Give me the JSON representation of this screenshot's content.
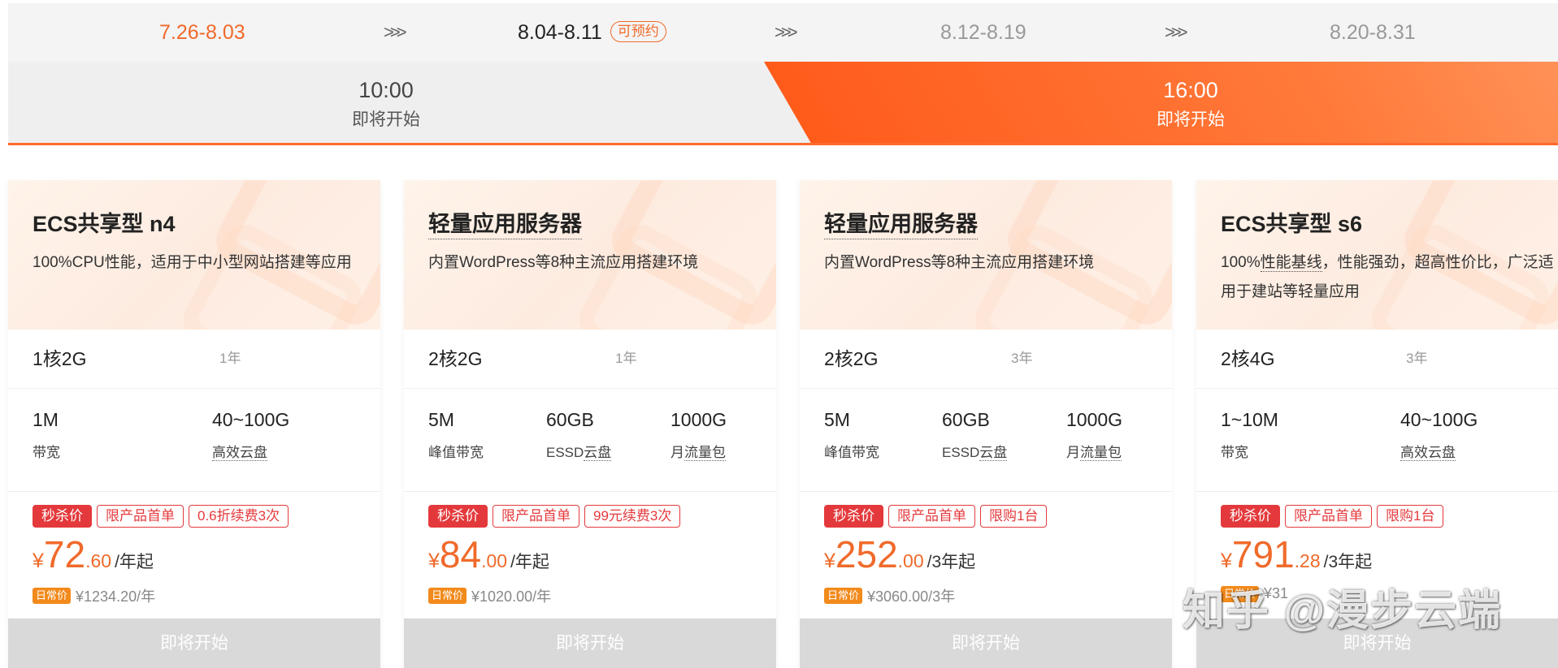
{
  "dates": [
    {
      "label": "7.26-8.03",
      "state": "past"
    },
    {
      "label": "8.04-8.11",
      "state": "active",
      "badge": "可预约"
    },
    {
      "label": "8.12-8.19",
      "state": "future"
    },
    {
      "label": "8.20-8.31",
      "state": "future"
    }
  ],
  "chevron": ">>>",
  "sessions": [
    {
      "time": "10:00",
      "status": "即将开始",
      "active": false
    },
    {
      "time": "16:00",
      "status": "即将开始",
      "active": true
    }
  ],
  "cards": [
    {
      "name": "ECS共享型 n4",
      "desc_pre": "100%CPU性能，适用于中小型网站搭建等应用",
      "desc_u": "",
      "desc_post": "",
      "spec": "1核2G",
      "term": "1年",
      "features": [
        {
          "value": "1M",
          "label": "带宽",
          "label_u": ""
        },
        {
          "value": "40~100G",
          "label": "",
          "label_u": "高效云盘"
        }
      ],
      "tags": [
        "秒杀价",
        "限产品首单",
        "0.6折续费3次"
      ],
      "price_currency": "¥",
      "price_int": "72",
      "price_dec": ".60",
      "price_unit": "/年起",
      "daily_tag": "日常价",
      "daily_price": "¥1234.20/年",
      "button": "即将开始"
    },
    {
      "name": "轻量应用服务器",
      "desc_pre": "内置WordPress等8种主流应用搭建环境",
      "desc_u": "",
      "desc_post": "",
      "spec": "2核2G",
      "term": "1年",
      "features": [
        {
          "value": "5M",
          "label": "峰值带宽",
          "label_u": ""
        },
        {
          "value": "60GB",
          "label": "ESSD",
          "label_u": "云盘"
        },
        {
          "value": "1000G",
          "label": "月",
          "label_u": "流量包"
        }
      ],
      "tags": [
        "秒杀价",
        "限产品首单",
        "99元续费3次"
      ],
      "price_currency": "¥",
      "price_int": "84",
      "price_dec": ".00",
      "price_unit": "/年起",
      "daily_tag": "日常价",
      "daily_price": "¥1020.00/年",
      "button": "即将开始"
    },
    {
      "name": "轻量应用服务器",
      "desc_pre": "内置WordPress等8种主流应用搭建环境",
      "desc_u": "",
      "desc_post": "",
      "spec": "2核2G",
      "term": "3年",
      "features": [
        {
          "value": "5M",
          "label": "峰值带宽",
          "label_u": ""
        },
        {
          "value": "60GB",
          "label": "ESSD",
          "label_u": "云盘"
        },
        {
          "value": "1000G",
          "label": "月",
          "label_u": "流量包"
        }
      ],
      "tags": [
        "秒杀价",
        "限产品首单",
        "限购1台"
      ],
      "price_currency": "¥",
      "price_int": "252",
      "price_dec": ".00",
      "price_unit": "/3年起",
      "daily_tag": "日常价",
      "daily_price": "¥3060.00/3年",
      "button": "即将开始"
    },
    {
      "name": "ECS共享型 s6",
      "desc_pre": "100%",
      "desc_u": "性能基线",
      "desc_post": "，性能强劲，超高性价比，广泛适用于建站等轻量应用",
      "spec": "2核4G",
      "term": "3年",
      "features": [
        {
          "value": "1~10M",
          "label": "带宽",
          "label_u": ""
        },
        {
          "value": "40~100G",
          "label": "",
          "label_u": "高效云盘"
        }
      ],
      "tags": [
        "秒杀价",
        "限产品首单",
        "限购1台"
      ],
      "price_currency": "¥",
      "price_int": "791",
      "price_dec": ".28",
      "price_unit": "/3年起",
      "daily_tag": "日常价",
      "daily_price": "¥31",
      "button": "即将开始"
    }
  ],
  "watermark": "知乎 @漫步云端",
  "colors": {
    "accent": "#f06a2a",
    "session_active": "#ff5b1b",
    "tag_red": "#e4393c",
    "button_disabled": "#d9d9d9"
  }
}
